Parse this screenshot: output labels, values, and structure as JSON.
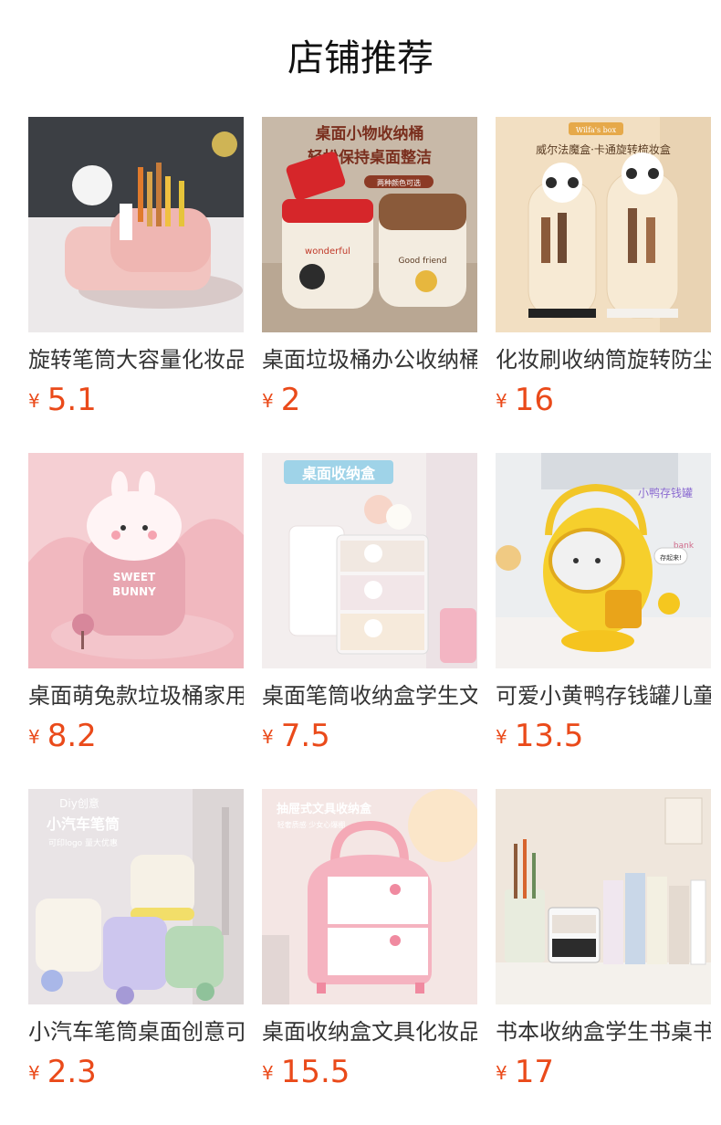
{
  "header": {
    "title": "店铺推荐"
  },
  "products": [
    {
      "name": "旋转笔筒大容量化妆品收纳盒",
      "currency": "¥",
      "price": "5.1",
      "image_text": []
    },
    {
      "name": "桌面垃圾桶办公收纳桶",
      "currency": "¥",
      "price": "2",
      "image_text": [
        "桌面小物收纳桶",
        "轻松保持桌面整洁",
        "两种颜色可选",
        "wonderful",
        "Good friend"
      ]
    },
    {
      "name": "化妆刷收纳筒旋转防尘",
      "currency": "¥",
      "price": "16",
      "image_text": [
        "Wilfa's box",
        "威尔法魔盒·卡通旋转梳妆盒"
      ]
    },
    {
      "name": "桌面萌兔款垃圾桶家用",
      "currency": "¥",
      "price": "8.2",
      "image_text": [
        "SWEET",
        "BUNNY"
      ]
    },
    {
      "name": "桌面笔筒收纳盒学生文具",
      "currency": "¥",
      "price": "7.5",
      "image_text": [
        "桌面收纳盒"
      ]
    },
    {
      "name": "可爱小黄鸭存钱罐儿童",
      "currency": "¥",
      "price": "13.5",
      "image_text": [
        "小鸭存钱罐",
        "bank",
        "存起来!"
      ]
    },
    {
      "name": "小汽车笔筒桌面创意可爱",
      "currency": "¥",
      "price": "2.3",
      "image_text": [
        "Diy创意",
        "小汽车笔筒",
        "可印logo 量大优惠"
      ]
    },
    {
      "name": "桌面收纳盒文具化妆品",
      "currency": "¥",
      "price": "15.5",
      "image_text": [
        "抽屉式文具收纳盒",
        "轻奢质感 少女心爆棚"
      ]
    },
    {
      "name": "书本收纳盒学生书桌书立",
      "currency": "¥",
      "price": "17",
      "image_text": []
    }
  ],
  "colors": {
    "price": "#ea4a1a",
    "title": "#111111",
    "name": "#333333"
  }
}
